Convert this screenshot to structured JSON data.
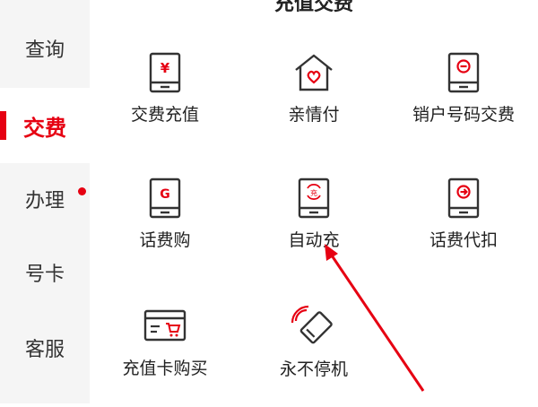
{
  "header": {
    "title": "充值交费"
  },
  "sidebar": {
    "items": [
      {
        "label": "查询"
      },
      {
        "label": "交费"
      },
      {
        "label": "办理"
      },
      {
        "label": "号卡"
      },
      {
        "label": "客服"
      }
    ]
  },
  "grid": {
    "items": [
      {
        "label": "交费充值",
        "icon": "phone-yuan-icon",
        "glyph": "¥"
      },
      {
        "label": "亲情付",
        "icon": "home-heart-icon"
      },
      {
        "label": "销户号码交费",
        "icon": "phone-minus-icon"
      },
      {
        "label": "话费购",
        "icon": "phone-g-icon",
        "glyph": "G"
      },
      {
        "label": "自动充",
        "icon": "phone-auto-recharge-icon",
        "glyph": "充"
      },
      {
        "label": "话费代扣",
        "icon": "phone-arrow-icon"
      },
      {
        "label": "充值卡购买",
        "icon": "card-cart-icon"
      },
      {
        "label": "永不停机",
        "icon": "phone-signal-icon"
      }
    ]
  },
  "colors": {
    "accent": "#e60012",
    "icon_stroke": "#333333",
    "sidebar_bg": "#f5f5f5"
  }
}
